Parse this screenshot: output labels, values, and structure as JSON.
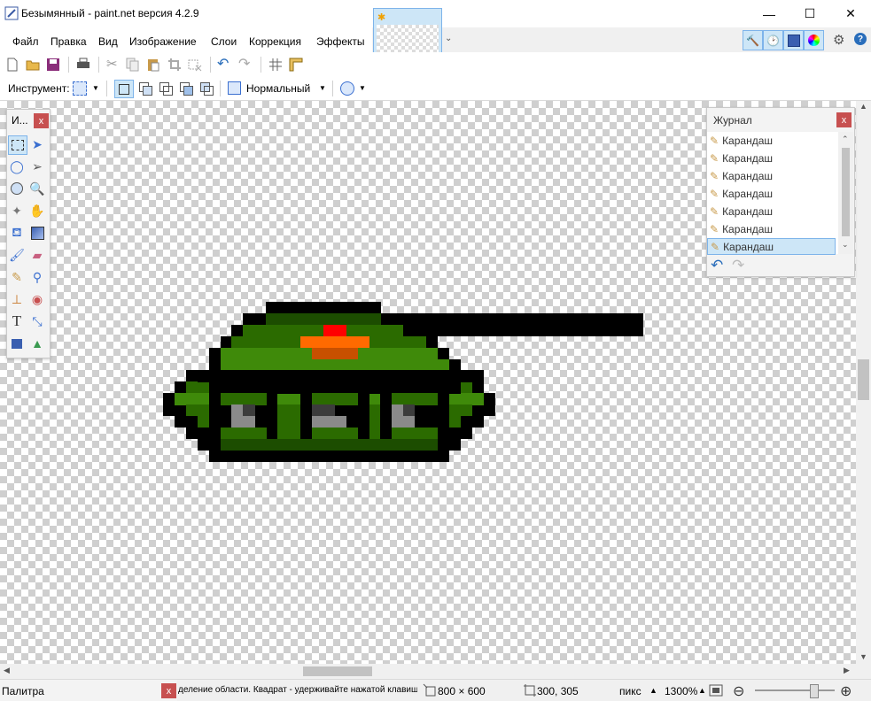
{
  "window": {
    "title": "Безымянный - paint.net версия 4.2.9",
    "minimize": "—",
    "maximize": "☐",
    "close": "✕"
  },
  "menu": [
    "Файл",
    "Правка",
    "Вид",
    "Изображение",
    "Слои",
    "Коррекция",
    "Эффекты"
  ],
  "toolbar2": {
    "tool_label": "Инструмент:",
    "blend_mode": "Нормальный"
  },
  "tools_panel": {
    "title": "И...",
    "close": "x"
  },
  "history_panel": {
    "title": "Журнал",
    "close": "x",
    "items": [
      "Карандаш",
      "Карандаш",
      "Карандаш",
      "Карандаш",
      "Карандаш",
      "Карандаш",
      "Карандаш"
    ],
    "selected_index": 6
  },
  "palette": {
    "title": "Палитра",
    "close": "x"
  },
  "status": {
    "hint": "деление области. Квадрат - удерживайте нажатой клавишу Shift.",
    "image_size": "800 × 600",
    "cursor_pos": "300, 305",
    "units": "пикс",
    "zoom": "1300%"
  },
  "colors": {
    "tank_dark": "#1c4d00",
    "tank_mid": "#2b6b00",
    "tank_light": "#3f8a0a",
    "outline": "#000000",
    "red": "#ff0000",
    "orange": "#ff6a00",
    "rust": "#c85000",
    "gray_light": "#8a8a8a",
    "gray_dark": "#3c3c3c"
  }
}
